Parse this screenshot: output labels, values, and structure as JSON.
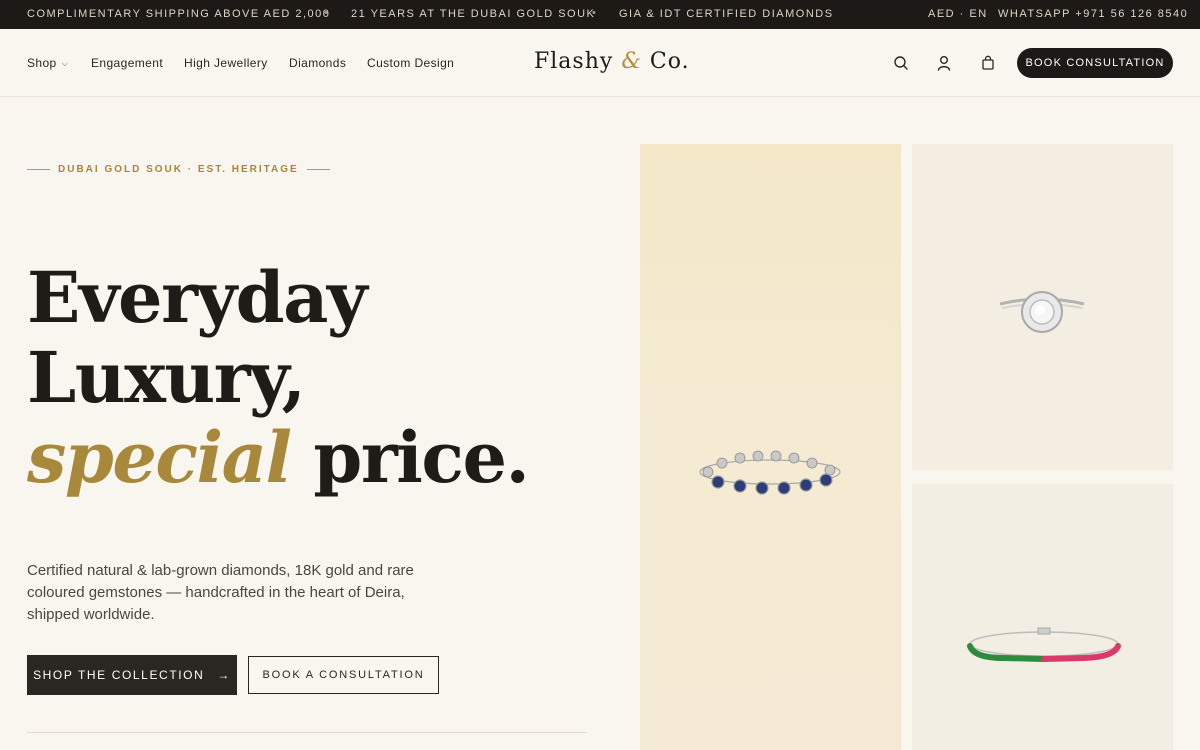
{
  "announcement": {
    "left": [
      "COMPLIMENTARY SHIPPING ABOVE AED 2,000",
      "21 YEARS AT THE DUBAI GOLD SOUK",
      "GIA & IDT CERTIFIED DIAMONDS"
    ],
    "separator": "•",
    "locale": "AED · EN",
    "whatsapp": "WHATSAPP +971 56 126 8540"
  },
  "header": {
    "nav": [
      {
        "label": "Shop"
      },
      {
        "label": "Engagement"
      },
      {
        "label": "High Jewellery"
      },
      {
        "label": "Diamonds"
      },
      {
        "label": "Custom Design"
      }
    ],
    "dropdown_icon": "chevron-down-icon",
    "logo": {
      "part1": "Flashy",
      "amp": "&",
      "part2": "Co."
    },
    "icons": [
      "search-icon",
      "user-icon",
      "bag-icon"
    ],
    "cta": "BOOK CONSULTATION"
  },
  "hero": {
    "eyebrow": "DUBAI GOLD SOUK · EST. HERITAGE",
    "headline": {
      "line1": "Everyday",
      "line2": "Luxury,",
      "italic": "special",
      "tail": " price."
    },
    "subcopy": "Certified natural & lab-grown diamonds, 18K gold and rare coloured gemstones — handcrafted in the heart of Deira, shipped worldwide.",
    "primary_cta": "SHOP THE COLLECTION",
    "primary_arrow": "→",
    "secondary_cta": "BOOK A CONSULTATION"
  },
  "gallery": {
    "items": [
      "sapphire-clover-bracelet",
      "diamond-halo-ring",
      "emerald-ruby-tennis-bracelet"
    ]
  },
  "colors": {
    "accent_gold": "#a8893b",
    "dark": "#1c1916",
    "background": "#f9f6ef"
  }
}
